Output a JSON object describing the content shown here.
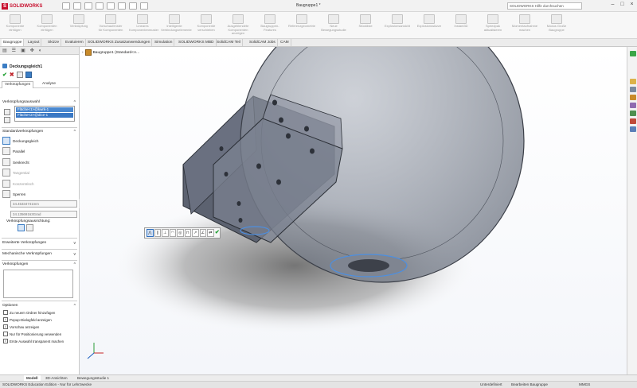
{
  "app": {
    "logo_text": "SOLIDWORKS",
    "doc_title": "Baugruppe1 *",
    "help_placeholder": "SOLIDWORKS Hilfe durchsuchen"
  },
  "ribbon": [
    {
      "label": "Komponente einfügen",
      "icon": "insert-component-icon"
    },
    {
      "label": "Komponenten einfügen",
      "icon": "insert-components-icon"
    },
    {
      "label": "Verknüpfung",
      "icon": "mate-icon"
    },
    {
      "label": "Vorschaufenster für Komponenten",
      "icon": "preview-icon"
    },
    {
      "label": "Lineares Komponentenmuster",
      "icon": "linear-pattern-icon"
    },
    {
      "label": "Intelligente Verbindungselemente",
      "icon": "smart-fasteners-icon"
    },
    {
      "label": "Komponente verschieben",
      "icon": "move-component-icon"
    },
    {
      "label": "Ausgeblendete Komponenten anzeigen",
      "icon": "show-hidden-icon"
    },
    {
      "label": "Baugruppen-Features",
      "icon": "assembly-features-icon"
    },
    {
      "label": "Referenzgeometrie",
      "icon": "reference-geometry-icon"
    },
    {
      "label": "Neue Bewegungsstudie",
      "icon": "motion-study-icon"
    },
    {
      "label": "Stückliste",
      "icon": "bom-icon"
    },
    {
      "label": "Explosionsansicht",
      "icon": "exploded-view-icon"
    },
    {
      "label": "Explosionsskizze",
      "icon": "explode-sketch-icon"
    },
    {
      "label": "Instant3D",
      "icon": "instant3d-icon"
    },
    {
      "label": "Speedpak aktualisieren",
      "icon": "speedpak-icon"
    },
    {
      "label": "Momentaufnahme machen",
      "icon": "snapshot-icon"
    },
    {
      "label": "Modus Große Baugruppe",
      "icon": "large-assembly-icon"
    }
  ],
  "tabs": [
    "Baugruppe",
    "Layout",
    "Skizze",
    "Evaluieren",
    "SOLIDWORKS Zusatzanwendungen",
    "Simulation",
    "SOLIDWORKS MBD",
    "SolidCAM Teil",
    "SolidCAM Jobs",
    "CAM"
  ],
  "property_manager": {
    "title": "Deckungsgleich1",
    "tab_mates": "Verknüpfungen",
    "tab_analysis": "Analyse",
    "selection_header": "Verknüpfungsauswahl",
    "selections": [
      "Fläche<1>@kwrk-1",
      "Fläche<2>@dice-1"
    ],
    "standard_header": "Standardverknüpfungen",
    "mates": [
      {
        "label": "Deckungsgleich",
        "icon": "coincident-icon",
        "active": true
      },
      {
        "label": "Parallel",
        "icon": "parallel-icon",
        "active": false
      },
      {
        "label": "Senkrecht",
        "icon": "perpendicular-icon",
        "active": false
      },
      {
        "label": "Tangential",
        "icon": "tangent-icon",
        "active": false
      },
      {
        "label": "Konzentrisch",
        "icon": "concentric-icon",
        "active": false
      },
      {
        "label": "Sperren",
        "icon": "lock-icon",
        "active": false
      }
    ],
    "distance_value": "34.45334741mm",
    "angle_value": "34.13569163Grad",
    "alignment_label": "Verknüpfungsausrichtung:",
    "advanced_header": "Erweiterte Verknüpfungen",
    "mechanical_header": "Mechanische Verknüpfungen",
    "mates_list_header": "Verknüpfungen",
    "options_header": "Optionen",
    "options": [
      {
        "label": "Zu neuem Ordner hinzufügen",
        "checked": false
      },
      {
        "label": "Popup-Dialogfeld anzeigen",
        "checked": true
      },
      {
        "label": "Vorschau anzeigen",
        "checked": true
      },
      {
        "label": "Nur für Positionierung verwenden",
        "checked": false
      },
      {
        "label": "Erste Auswahl transparent machen",
        "checked": true
      }
    ]
  },
  "tree": {
    "root": "Baugruppe1 (Standard<A..."
  },
  "bottom_tabs": [
    "Modell",
    "3D-Ansichten",
    "Bewegungsstudie 1"
  ],
  "status": {
    "left": "SOLIDWORKS Education Edition - Nur für Lehrzwecke",
    "definition": "Unterdefiniert",
    "editing": "Bearbeiten Baugruppe",
    "units": "MMGS"
  }
}
